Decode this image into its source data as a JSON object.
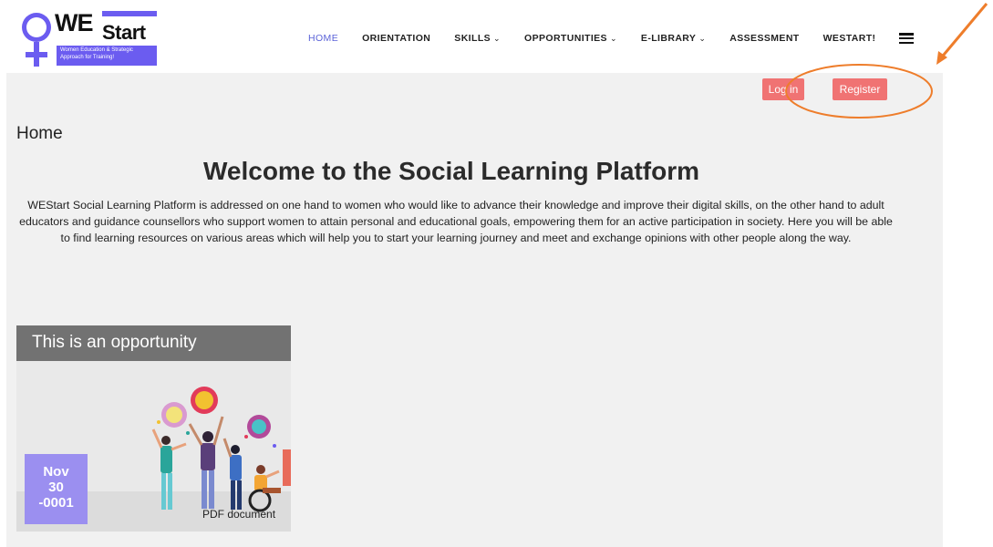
{
  "logo": {
    "we": "WE",
    "start": "Start",
    "tagline": "Women Education & Strategic Approach for Training!"
  },
  "nav": {
    "items": [
      {
        "label": "HOME",
        "has_dropdown": false,
        "active": true
      },
      {
        "label": "ORIENTATION",
        "has_dropdown": false,
        "active": false
      },
      {
        "label": "SKILLS",
        "has_dropdown": true,
        "active": false
      },
      {
        "label": "OPPORTUNITIES",
        "has_dropdown": true,
        "active": false
      },
      {
        "label": "E-LIBRARY",
        "has_dropdown": true,
        "active": false
      },
      {
        "label": "ASSESSMENT",
        "has_dropdown": false,
        "active": false
      },
      {
        "label": "WESTART!",
        "has_dropdown": false,
        "active": false
      }
    ],
    "chevron": "⌄",
    "menu_icon": "hamburger-icon"
  },
  "auth": {
    "login_label": "Log in",
    "register_label": "Register"
  },
  "page": {
    "breadcrumb": "Home",
    "title": "Welcome to the Social Learning Platform",
    "intro": "WEStart Social Learning Platform is addressed on one hand to women who would like to advance their knowledge and improve their digital skills, on the other hand to adult educators and guidance counsellors who support women to attain personal and educational goals, empowering them for an active participation in society. Here you will be able to find learning resources on various areas which will help you to start your learning journey and meet and exchange opinions with other people along the way."
  },
  "card": {
    "title": "This is an opportunity",
    "date_month": "Nov",
    "date_day": "30",
    "date_year": "-0001",
    "attachment": "PDF document"
  },
  "colors": {
    "accent": "#5b63d8",
    "brand_purple": "#6b5cf0",
    "button": "#f07373",
    "badge": "#9b8ff0",
    "annotation": "#ee7d2b"
  }
}
